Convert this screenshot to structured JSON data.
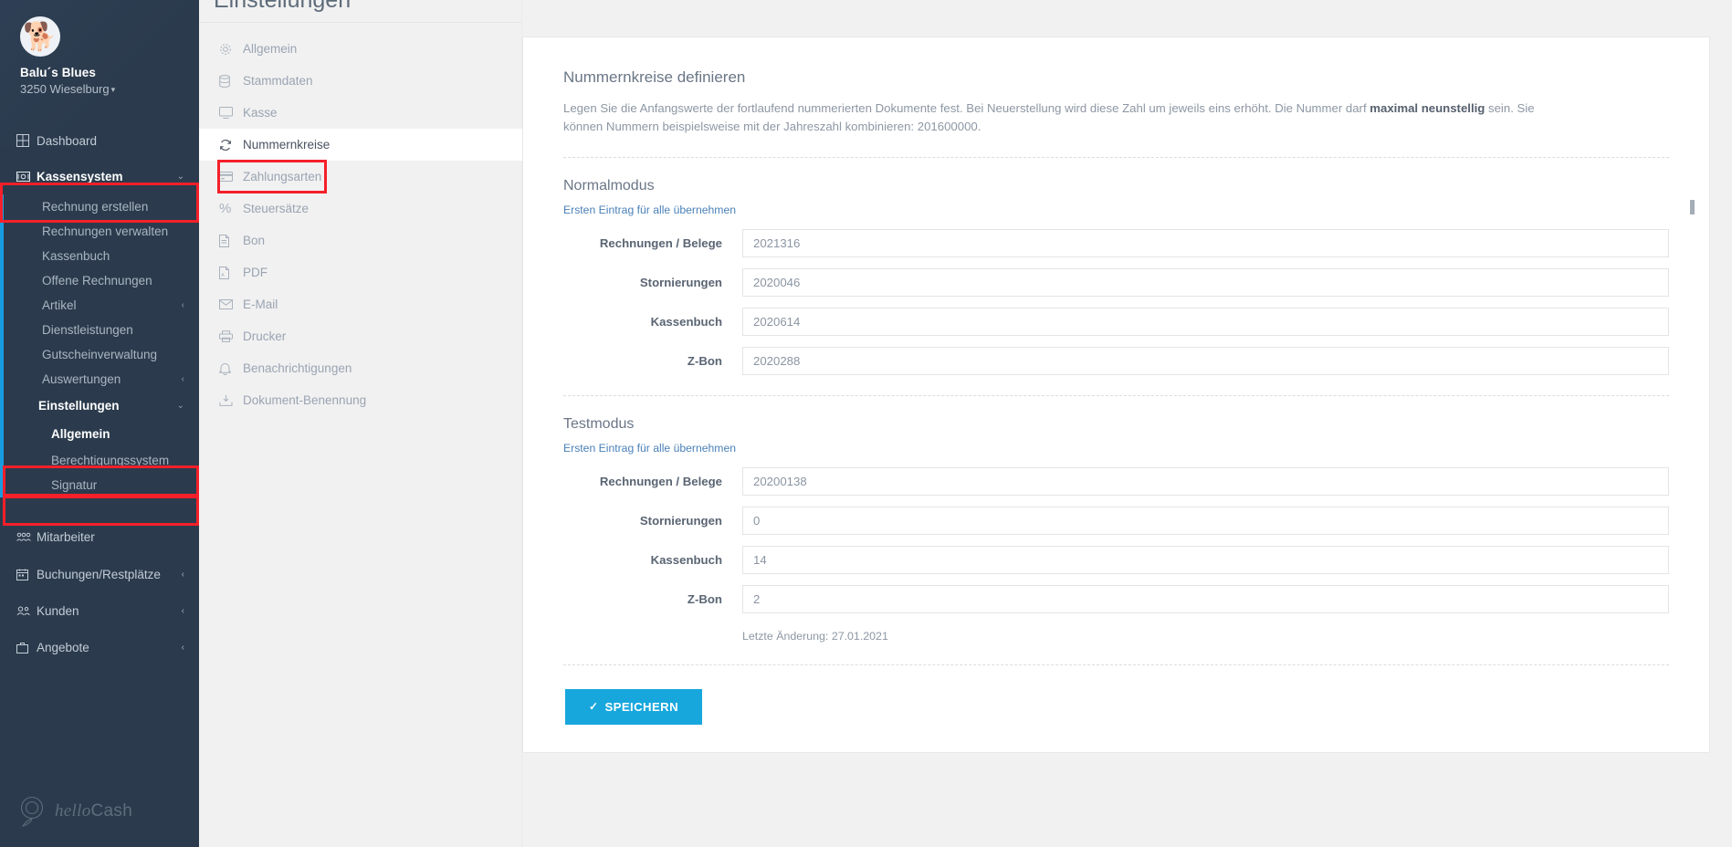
{
  "brand": {
    "name": "Balu´s Blues",
    "location": "3250 Wieselburg",
    "caret": "▾",
    "logo_text_1": "hello",
    "logo_text_2": "Cash"
  },
  "sidebar": {
    "items": [
      {
        "label": "Dashboard",
        "icon": "dashboard-icon",
        "chevron": ""
      },
      {
        "label": "Kassensystem",
        "icon": "cash-register-icon",
        "chevron": "⌄"
      }
    ],
    "kassensystem_sub": [
      {
        "label": "Rechnung erstellen",
        "chevron": ""
      },
      {
        "label": "Rechnungen verwalten",
        "chevron": ""
      },
      {
        "label": "Kassenbuch",
        "chevron": ""
      },
      {
        "label": "Offene Rechnungen",
        "chevron": ""
      },
      {
        "label": "Artikel",
        "chevron": "‹"
      },
      {
        "label": "Dienstleistungen",
        "chevron": ""
      },
      {
        "label": "Gutscheinverwaltung",
        "chevron": ""
      },
      {
        "label": "Auswertungen",
        "chevron": "‹"
      }
    ],
    "einstellungen": {
      "label": "Einstellungen",
      "chevron": "⌄"
    },
    "einstellungen_sub": [
      {
        "label": "Allgemein",
        "chevron": "",
        "active": true
      },
      {
        "label": "Berechtigungssystem",
        "chevron": ""
      },
      {
        "label": "Signatur",
        "chevron": ""
      }
    ],
    "bottom_items": [
      {
        "label": "Mitarbeiter",
        "icon": "employees-icon",
        "chevron": ""
      },
      {
        "label": "Buchungen/Restplätze",
        "icon": "calendar-icon",
        "chevron": "‹"
      },
      {
        "label": "Kunden",
        "icon": "customers-icon",
        "chevron": "‹"
      },
      {
        "label": "Angebote",
        "icon": "briefcase-icon",
        "chevron": "‹"
      }
    ]
  },
  "page": {
    "title": "Einstellungen"
  },
  "settings_nav": [
    {
      "label": "Allgemein",
      "icon": "gear-icon",
      "active": false
    },
    {
      "label": "Stammdaten",
      "icon": "database-icon",
      "active": false
    },
    {
      "label": "Kasse",
      "icon": "monitor-icon",
      "active": false
    },
    {
      "label": "Nummernkreise",
      "icon": "refresh-icon",
      "active": true
    },
    {
      "label": "Zahlungsarten",
      "icon": "credit-card-icon",
      "active": false
    },
    {
      "label": "Steuersätze",
      "icon": "percent-icon",
      "active": false
    },
    {
      "label": "Bon",
      "icon": "file-text-icon",
      "active": false
    },
    {
      "label": "PDF",
      "icon": "file-pdf-icon",
      "active": false
    },
    {
      "label": "E-Mail",
      "icon": "envelope-icon",
      "active": false
    },
    {
      "label": "Drucker",
      "icon": "printer-icon",
      "active": false
    },
    {
      "label": "Benachrichtigungen",
      "icon": "bell-icon",
      "active": false
    },
    {
      "label": "Dokument-Benennung",
      "icon": "document-download-icon",
      "active": false
    }
  ],
  "content": {
    "heading": "Nummernkreise definieren",
    "intro_part1": "Legen Sie die Anfangswerte der fortlaufend nummerierten Dokumente fest. Bei Neuerstellung wird diese Zahl um jeweils eins erhöht. Die Nummer darf ",
    "intro_bold1": "maximal neunstellig",
    "intro_part2": " sein. Sie können Nummern beispielsweise mit der Jahreszahl kombinieren: 201600000.",
    "normal": {
      "heading": "Normalmodus",
      "apply_link": "Ersten Eintrag für alle übernehmen",
      "fields": [
        {
          "label": "Rechnungen / Belege",
          "value": "2021316"
        },
        {
          "label": "Stornierungen",
          "value": "2020046"
        },
        {
          "label": "Kassenbuch",
          "value": "2020614"
        },
        {
          "label": "Z-Bon",
          "value": "2020288"
        }
      ]
    },
    "test": {
      "heading": "Testmodus",
      "apply_link": "Ersten Eintrag für alle übernehmen",
      "fields": [
        {
          "label": "Rechnungen / Belege",
          "value": "20200138"
        },
        {
          "label": "Stornierungen",
          "value": "0"
        },
        {
          "label": "Kassenbuch",
          "value": "14"
        },
        {
          "label": "Z-Bon",
          "value": "2"
        }
      ]
    },
    "last_change": "Letzte Änderung: 27.01.2021",
    "save_button": "SPEICHERN",
    "save_check": "✓"
  },
  "colors": {
    "sidebar_bg": "#2b3b4d",
    "accent_blue": "#189ce0",
    "save_blue": "#18a7dd",
    "link_blue": "#4a81b8",
    "highlight_red": "#f5202a"
  }
}
